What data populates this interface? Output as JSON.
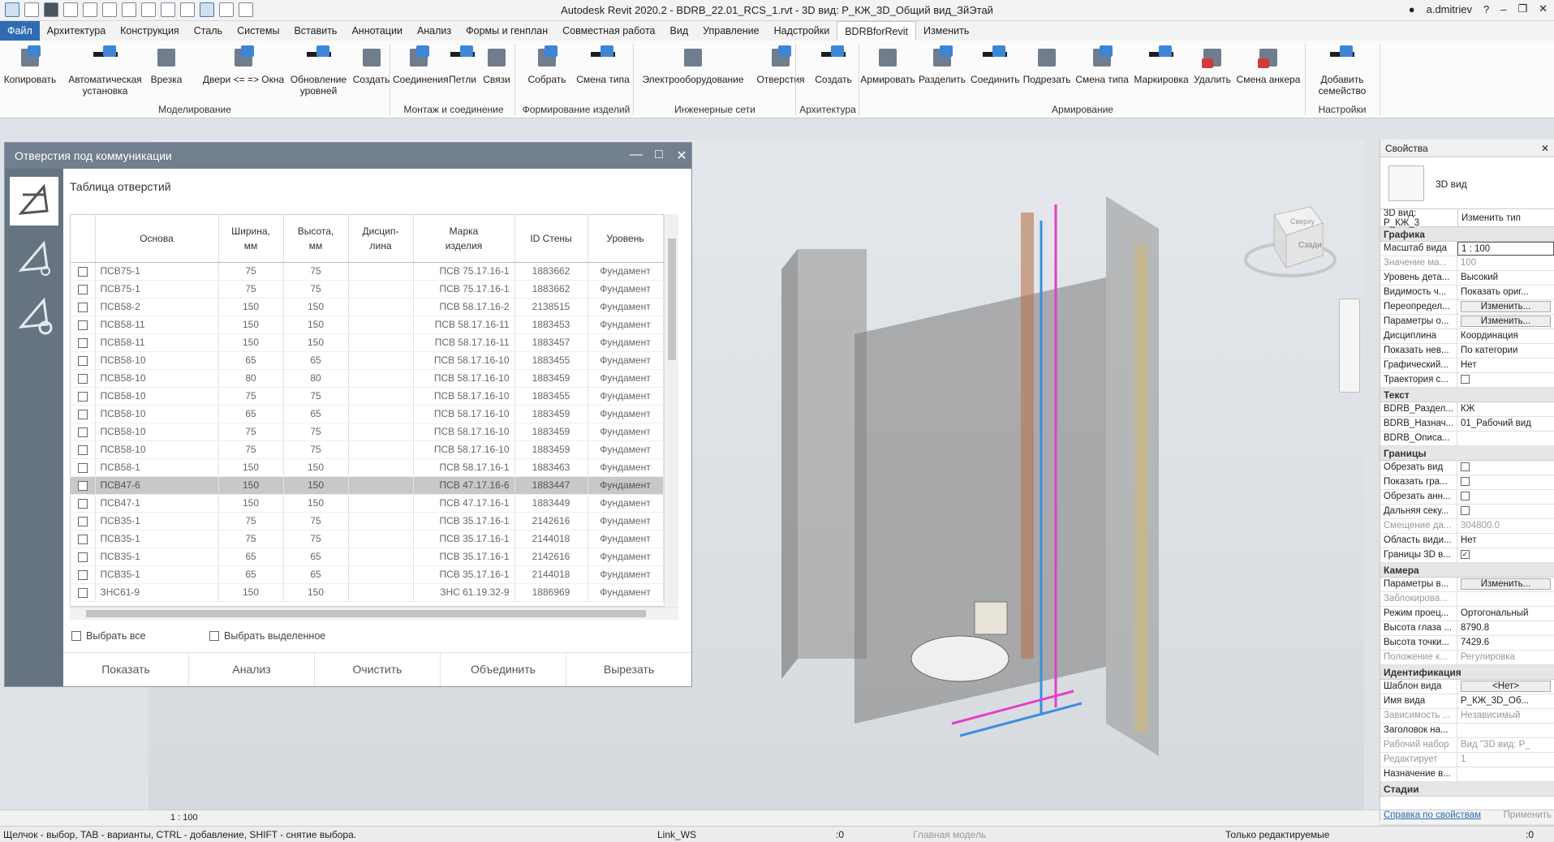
{
  "window": {
    "title": "Autodesk Revit 2020.2 - BDRB_22.01_RCS_1.rvt - 3D вид: Р_КЖ_3D_Общий вид_ЗйЭтай",
    "user": "a.dmitriev"
  },
  "ribbon_tabs": [
    "Файл",
    "Архитектура",
    "Конструкция",
    "Сталь",
    "Системы",
    "Вставить",
    "Аннотации",
    "Анализ",
    "Формы и генплан",
    "Совместная работа",
    "Вид",
    "Управление",
    "Надстройки",
    "BDRBforRevit",
    "Изменить"
  ],
  "ribbon": {
    "buttons": [
      {
        "label": "Копировать"
      },
      {
        "label": "Автоматическая установка"
      },
      {
        "label": "Врезка"
      },
      {
        "label": "Двери <= => Окна"
      },
      {
        "label": "Обновление уровней"
      },
      {
        "label": "Создать"
      },
      {
        "label": "Соединения"
      },
      {
        "label": "Петли"
      },
      {
        "label": "Связи"
      },
      {
        "label": "Собрать"
      },
      {
        "label": "Смена типа"
      },
      {
        "label": "Электрооборудование"
      },
      {
        "label": "Отверстия"
      },
      {
        "label": "Создать"
      },
      {
        "label": "Армировать"
      },
      {
        "label": "Разделить"
      },
      {
        "label": "Соединить"
      },
      {
        "label": "Подрезать"
      },
      {
        "label": "Смена типа"
      },
      {
        "label": "Маркировка"
      },
      {
        "label": "Удалить"
      },
      {
        "label": "Смена анкера"
      },
      {
        "label": "Добавить семейство"
      }
    ],
    "groups": [
      "Моделирование",
      "Монтаж и соединение",
      "Формирование изделий",
      "Инженерные сети",
      "Архитектура",
      "Армирование",
      "Настройки"
    ]
  },
  "dialog": {
    "title": "Отверстия под коммуникации",
    "table_title": "Таблица отверстий",
    "columns": [
      "Основа",
      "Ширина, мм",
      "Высота, мм",
      "Дисцип-лина",
      "Марка изделия",
      "ID Стены",
      "Уровень"
    ],
    "rows": [
      [
        "ПСВ75-1",
        "75",
        "75",
        "",
        "ПСВ 75.17.16-1",
        "1883662",
        "Фундамент"
      ],
      [
        "ПСВ75-1",
        "75",
        "75",
        "",
        "ПСВ 75.17.16-1",
        "1883662",
        "Фундамент"
      ],
      [
        "ПСВ58-2",
        "150",
        "150",
        "",
        "ПСВ 58.17.16-2",
        "2138515",
        "Фундамент"
      ],
      [
        "ПСВ58-11",
        "150",
        "150",
        "",
        "ПСВ 58.17.16-11",
        "1883453",
        "Фундамент"
      ],
      [
        "ПСВ58-11",
        "150",
        "150",
        "",
        "ПСВ 58.17.16-11",
        "1883457",
        "Фундамент"
      ],
      [
        "ПСВ58-10",
        "65",
        "65",
        "",
        "ПСВ 58.17.16-10",
        "1883455",
        "Фундамент"
      ],
      [
        "ПСВ58-10",
        "80",
        "80",
        "",
        "ПСВ 58.17.16-10",
        "1883459",
        "Фундамент"
      ],
      [
        "ПСВ58-10",
        "75",
        "75",
        "",
        "ПСВ 58.17.16-10",
        "1883455",
        "Фундамент"
      ],
      [
        "ПСВ58-10",
        "65",
        "65",
        "",
        "ПСВ 58.17.16-10",
        "1883459",
        "Фундамент"
      ],
      [
        "ПСВ58-10",
        "75",
        "75",
        "",
        "ПСВ 58.17.16-10",
        "1883459",
        "Фундамент"
      ],
      [
        "ПСВ58-10",
        "75",
        "75",
        "",
        "ПСВ 58.17.16-10",
        "1883459",
        "Фундамент"
      ],
      [
        "ПСВ58-1",
        "150",
        "150",
        "",
        "ПСВ 58.17.16-1",
        "1883463",
        "Фундамент"
      ],
      [
        "ПСВ47-6",
        "150",
        "150",
        "",
        "ПСВ 47.17.16-6",
        "1883447",
        "Фундамент"
      ],
      [
        "ПСВ47-1",
        "150",
        "150",
        "",
        "ПСВ 47.17.16-1",
        "1883449",
        "Фундамент"
      ],
      [
        "ПСВ35-1",
        "75",
        "75",
        "",
        "ПСВ 35.17.16-1",
        "2142616",
        "Фундамент"
      ],
      [
        "ПСВ35-1",
        "75",
        "75",
        "",
        "ПСВ 35.17.16-1",
        "2144018",
        "Фундамент"
      ],
      [
        "ПСВ35-1",
        "65",
        "65",
        "",
        "ПСВ 35.17.16-1",
        "2142616",
        "Фундамент"
      ],
      [
        "ПСВ35-1",
        "65",
        "65",
        "",
        "ПСВ 35.17.16-1",
        "2144018",
        "Фундамент"
      ],
      [
        "ЗНС61-9",
        "150",
        "150",
        "",
        "ЗНС 61.19.32-9",
        "1886969",
        "Фундамент"
      ]
    ],
    "selected_row": 12,
    "select_all": "Выбрать все",
    "select_highlighted": "Выбрать выделенное",
    "buttons": [
      "Показать",
      "Анализ",
      "Очистить",
      "Объединить",
      "Вырезать"
    ]
  },
  "viewcube": {
    "face": "Сзади",
    "top": "Сверху"
  },
  "properties": {
    "header": "Свойства",
    "type_name": "3D вид",
    "view_selector": "3D вид: Р_КЖ_3",
    "edit_type": "Изменить тип",
    "categories": [
      {
        "name": "Графика",
        "rows": [
          {
            "n": "Масштаб вида",
            "v": "1 : 100",
            "kind": "input"
          },
          {
            "n": "Значение ма...",
            "v": "100",
            "kind": "dim"
          },
          {
            "n": "Уровень дета...",
            "v": "Высокий"
          },
          {
            "n": "Видимость ч...",
            "v": "Показать ориг..."
          },
          {
            "n": "Переопредел...",
            "v": "Изменить...",
            "kind": "button"
          },
          {
            "n": "Параметры о...",
            "v": "Изменить...",
            "kind": "button"
          },
          {
            "n": "Дисциплина",
            "v": "Координация"
          },
          {
            "n": "Показать нев...",
            "v": "По категории"
          },
          {
            "n": "Графический...",
            "v": "Нет"
          },
          {
            "n": "Траектория с...",
            "v": "",
            "kind": "check"
          }
        ]
      },
      {
        "name": "Текст",
        "rows": [
          {
            "n": "BDRB_Раздел...",
            "v": "КЖ"
          },
          {
            "n": "BDRB_Назнач...",
            "v": "01_Рабочий вид"
          },
          {
            "n": "BDRB_Описа...",
            "v": ""
          }
        ]
      },
      {
        "name": "Границы",
        "rows": [
          {
            "n": "Обрезать вид",
            "v": "",
            "kind": "check"
          },
          {
            "n": "Показать гра...",
            "v": "",
            "kind": "check"
          },
          {
            "n": "Обрезать анн...",
            "v": "",
            "kind": "check"
          },
          {
            "n": "Дальняя секу...",
            "v": "",
            "kind": "check"
          },
          {
            "n": "Смещение да...",
            "v": "304800.0",
            "kind": "dim"
          },
          {
            "n": "Область види...",
            "v": "Нет"
          },
          {
            "n": "Границы 3D в...",
            "v": "✓",
            "kind": "check"
          }
        ]
      },
      {
        "name": "Камера",
        "rows": [
          {
            "n": "Параметры в...",
            "v": "Изменить...",
            "kind": "button"
          },
          {
            "n": "Заблокирова...",
            "v": "",
            "kind": "dim"
          },
          {
            "n": "Режим проец...",
            "v": "Ортогональный"
          },
          {
            "n": "Высота глаза ...",
            "v": "8790.8"
          },
          {
            "n": "Высота точки...",
            "v": "7429.6"
          },
          {
            "n": "Положение к...",
            "v": "Регулировка",
            "kind": "dim"
          }
        ]
      },
      {
        "name": "Идентификация",
        "rows": [
          {
            "n": "Шаблон вида",
            "v": "<Нет>",
            "kind": "button"
          },
          {
            "n": "Имя вида",
            "v": "Р_КЖ_3D_Об..."
          },
          {
            "n": "Зависимость ...",
            "v": "Независимый",
            "kind": "dim"
          },
          {
            "n": "Заголовок на...",
            "v": ""
          },
          {
            "n": "Рабочий набор",
            "v": "Вид \"3D вид: Р_",
            "kind": "dim"
          },
          {
            "n": "Редактирует",
            "v": "1",
            "kind": "dim"
          },
          {
            "n": "Назначение в...",
            "v": ""
          }
        ]
      },
      {
        "name": "Стадии",
        "rows": []
      }
    ],
    "help_link": "Справка по свойствам",
    "apply": "Применить"
  },
  "view_status": {
    "scale": "1 : 100"
  },
  "status": {
    "hint": "Щелчок - выбор, TAB - варианты, CTRL - добавление, SHIFT - снятие выбора.",
    "workset": "Link_WS",
    "count": ":0",
    "model": "Главная модель",
    "editable_only": "Только редактируемые",
    "filter_count": ":0"
  }
}
